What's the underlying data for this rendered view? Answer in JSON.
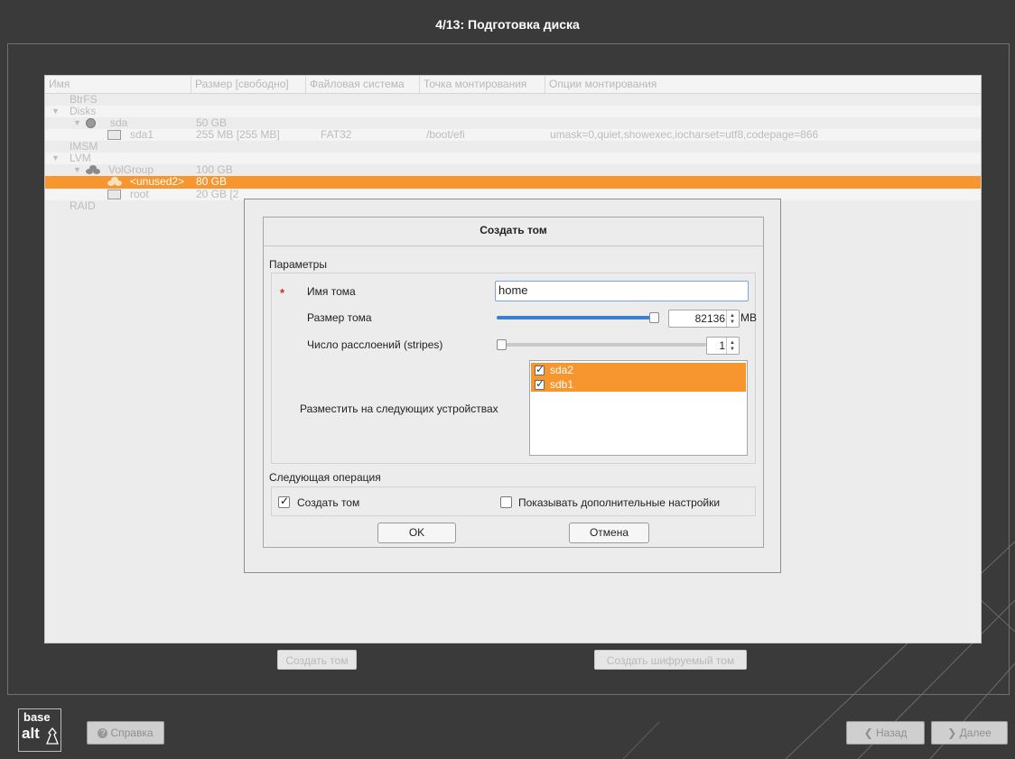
{
  "window": {
    "title": "4/13: Подготовка диска"
  },
  "tree": {
    "columns": [
      "Имя",
      "Размер [свободно]",
      "Файловая система",
      "Точка монтирования",
      "Опции монтирования"
    ],
    "rows": [
      {
        "name": "BtrFS"
      },
      {
        "name": "Disks"
      },
      {
        "name": "sda",
        "size": "50 GB"
      },
      {
        "name": "sda1",
        "size": "255 MB [255 MB]",
        "fs": "FAT32",
        "mount": "/boot/efi",
        "options": "umask=0,quiet,showexec,iocharset=utf8,codepage=866"
      },
      {
        "name": "IMSM"
      },
      {
        "name": "LVM"
      },
      {
        "name": "VolGroup",
        "size": "100 GB"
      },
      {
        "name": "<unused2>",
        "size": "80 GB"
      },
      {
        "name": "root",
        "size": "20 GB [2"
      },
      {
        "name": "RAID"
      }
    ]
  },
  "buttons": {
    "create_volume": "Создать том",
    "create_encrypted": "Создать шифруемый том",
    "help": "Справка",
    "back": "Назад",
    "next": "Далее"
  },
  "logo": {
    "line1": "base",
    "line2": "alt"
  },
  "dialog": {
    "title": "Создать том",
    "params_label": "Параметры",
    "required_marker": "*",
    "name_label": "Имя тома",
    "name_value": "home",
    "size_label": "Размер тома",
    "size_value": "82136",
    "size_unit": "MB",
    "size_slider_fraction": 1.0,
    "stripes_label": "Число расслоений (stripes)",
    "stripes_value": "1",
    "stripes_slider_fraction": 0.0,
    "devices_label": "Разместить на следующих устройствах",
    "devices": [
      {
        "name": "sda2",
        "checked": true
      },
      {
        "name": "sdb1",
        "checked": true
      }
    ],
    "next_op_label": "Следующая операция",
    "create_volume_check": {
      "label": "Создать том",
      "checked": true
    },
    "advanced_check": {
      "label": "Показывать дополнительные настройки",
      "checked": false
    },
    "ok": "OK",
    "cancel": "Отмена"
  },
  "colors": {
    "selection": "#f7962e",
    "slider_fill": "#3a7fd0",
    "required": "#d9261c"
  }
}
